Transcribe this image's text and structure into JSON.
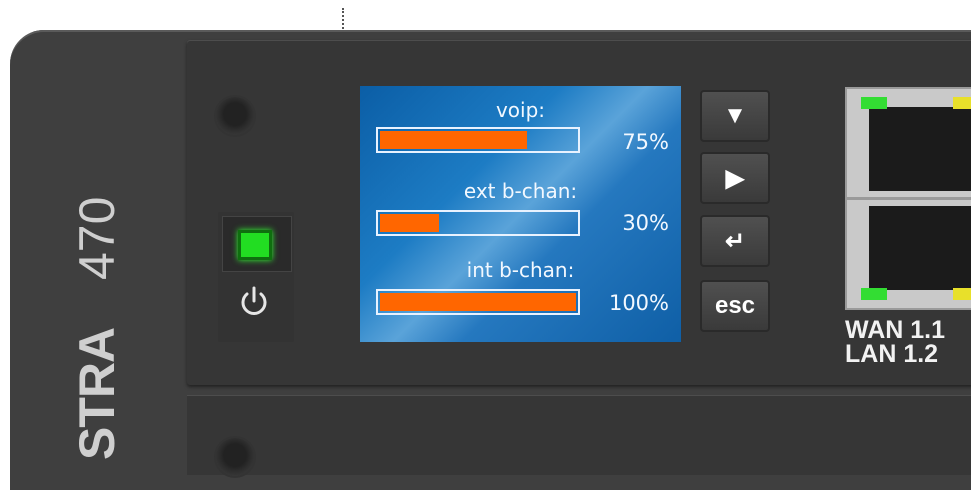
{
  "device": {
    "brand_text": "STRA",
    "model_text": "470"
  },
  "lcd": {
    "rows": [
      {
        "label": "voip:",
        "percent_text": "75%",
        "fill_fraction": 0.75
      },
      {
        "label": "ext b-chan:",
        "percent_text": "30%",
        "fill_fraction": 0.3
      },
      {
        "label": "int b-chan:",
        "percent_text": "100%",
        "fill_fraction": 1.0
      }
    ]
  },
  "nav_buttons": {
    "down_glyph": "▼",
    "right_glyph": "▶",
    "enter_glyph": "↵",
    "esc_label": "esc"
  },
  "ports": {
    "wan_label": "WAN 1.1",
    "lan_label": "LAN 1.2",
    "led_green": "#33dd33",
    "led_yellow": "#e8e02a"
  },
  "colors": {
    "bar_fill": "#ff6600",
    "power_led": "#22dd22",
    "lcd_blue": "#0b5ea6"
  }
}
